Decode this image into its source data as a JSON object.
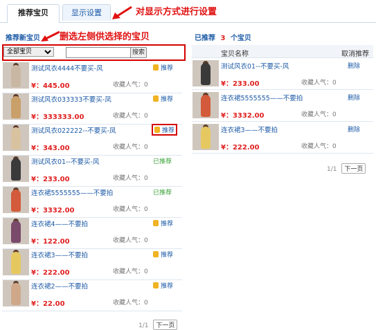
{
  "tabs": {
    "recommend": "推荐宝贝",
    "display": "显示设置"
  },
  "annotations": {
    "top": "对显示方式进行设置",
    "left": "删选左侧供选择的宝贝"
  },
  "left": {
    "title": "推荐新宝贝",
    "filter_selected": "全部宝贝",
    "search_value": "",
    "search_btn": "搜索",
    "items": [
      {
        "name": "测试风衣4444不要买-风",
        "price": "¥：445.00",
        "fav": "收藏人气：0",
        "status": "推荐",
        "done": false,
        "color": "#c9b7a3"
      },
      {
        "name": "测试风衣033333不要买-凤",
        "price": "¥：333333.00",
        "fav": "收藏人气：0",
        "status": "推荐",
        "done": false,
        "color": "#c9a06a"
      },
      {
        "name": "测试风衣022222--不要买-凤",
        "price": "¥：343.00",
        "fav": "收藏人气：0",
        "status": "推荐",
        "done": false,
        "color": "#d9c2a0"
      },
      {
        "name": "测试风衣01--不要买-风",
        "price": "¥：233.00",
        "fav": "收藏人气：0",
        "status": "已推荐",
        "done": true,
        "color": "#3a3a3a"
      },
      {
        "name": "连衣裙5555555——不要拍",
        "price": "¥：3332.00",
        "fav": "收藏人气：0",
        "status": "已推荐",
        "done": true,
        "color": "#d35a3a"
      },
      {
        "name": "连衣裙4——不要拍",
        "price": "¥：122.00",
        "fav": "收藏人气：0",
        "status": "推荐",
        "done": false,
        "color": "#7a4a6a"
      },
      {
        "name": "连衣裙3——不要拍",
        "price": "¥：222.00",
        "fav": "收藏人气：0",
        "status": "推荐",
        "done": false,
        "color": "#e6c860"
      },
      {
        "name": "连衣裙2——不要拍",
        "price": "¥：22.00",
        "fav": "收藏人气：0",
        "status": "推荐",
        "done": false,
        "color": "#cfa88a"
      }
    ],
    "pager": {
      "page": "1/1",
      "next": "下一页"
    }
  },
  "right": {
    "title_pre": "已推荐",
    "count": "3",
    "title_post": "个宝贝",
    "col_name": "宝贝名称",
    "col_action": "取消推荐",
    "items": [
      {
        "name": "测试风衣01--不要买-风",
        "price": "¥：233.00",
        "fav": "收藏人气：0",
        "action": "删除",
        "color": "#3a3a3a"
      },
      {
        "name": "连衣裙5555555——不要拍",
        "price": "¥：3332.00",
        "fav": "收藏人气：0",
        "action": "删除",
        "color": "#d35a3a"
      },
      {
        "name": "连衣裙3——不要拍",
        "price": "¥：222.00",
        "fav": "收藏人气：0",
        "action": "删除",
        "color": "#e6c860"
      }
    ],
    "pager": {
      "page": "1/1",
      "next": "下一页"
    }
  },
  "colors": {
    "accent": "#1c5aa6",
    "price": "#e02020",
    "highlight": "#d40000",
    "done": "#3aa23a"
  }
}
